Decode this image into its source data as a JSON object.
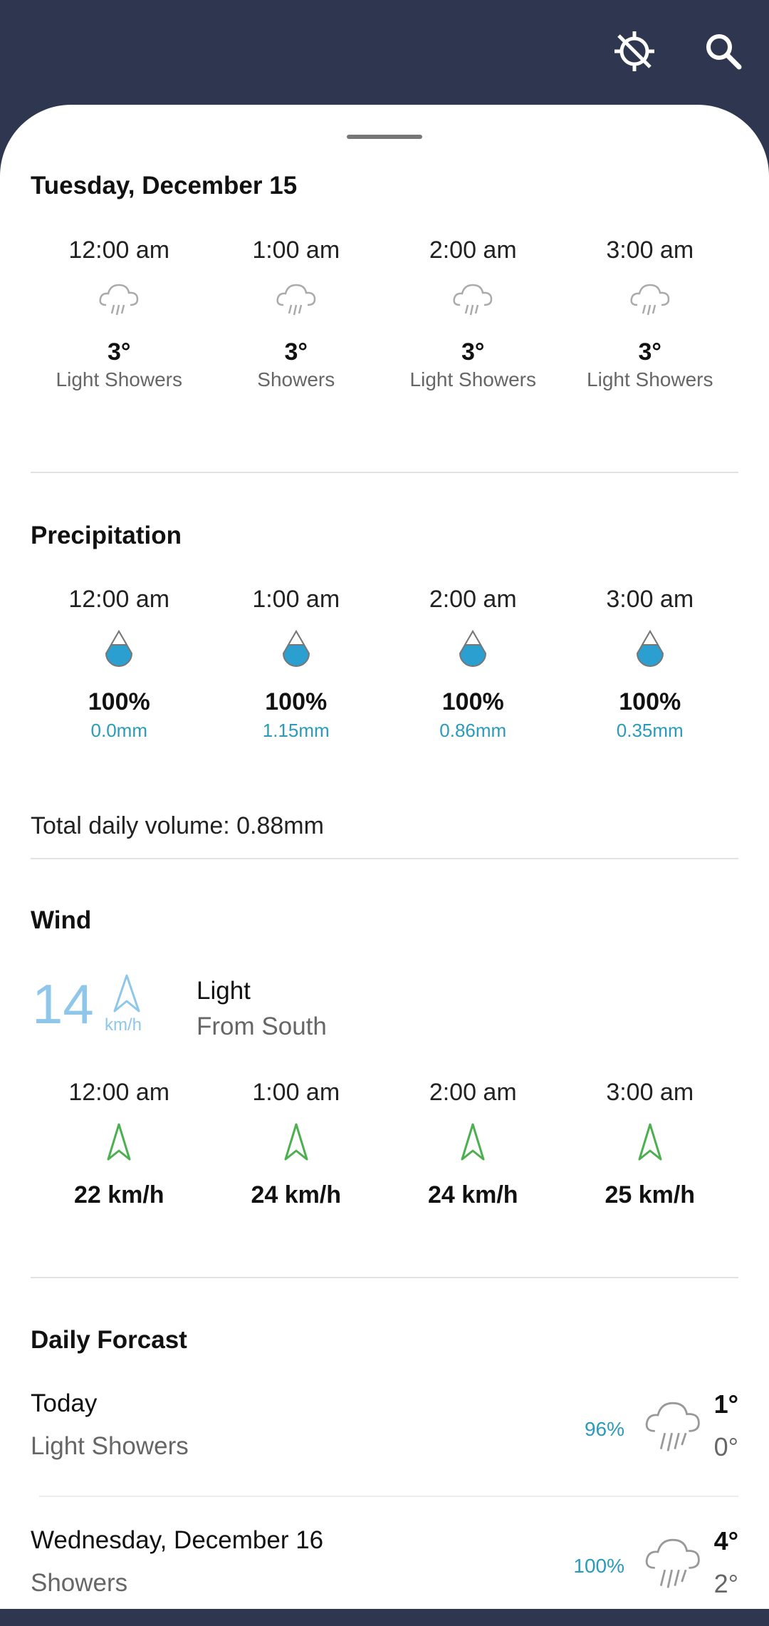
{
  "header": {
    "location_icon": "location-disabled-icon",
    "search_icon": "search-icon"
  },
  "hourly": {
    "date_title": "Tuesday, December 15",
    "items": [
      {
        "time": "12:00 am",
        "temp": "3°",
        "condition": "Light Showers",
        "icon": "rain-cloud-icon"
      },
      {
        "time": "1:00 am",
        "temp": "3°",
        "condition": "Showers",
        "icon": "rain-cloud-icon"
      },
      {
        "time": "2:00 am",
        "temp": "3°",
        "condition": "Light Showers",
        "icon": "rain-cloud-icon"
      },
      {
        "time": "3:00 am",
        "temp": "3°",
        "condition": "Light Showers",
        "icon": "rain-cloud-icon"
      }
    ]
  },
  "precipitation": {
    "title": "Precipitation",
    "items": [
      {
        "time": "12:00 am",
        "chance": "100%",
        "amount": "0.0mm"
      },
      {
        "time": "1:00 am",
        "chance": "100%",
        "amount": "1.15mm"
      },
      {
        "time": "2:00 am",
        "chance": "100%",
        "amount": "0.86mm"
      },
      {
        "time": "3:00 am",
        "chance": "100%",
        "amount": "0.35mm"
      }
    ],
    "total": "Total daily volume: 0.88mm",
    "drop_color": "#2a9fd0"
  },
  "wind": {
    "title": "Wind",
    "current_speed": "14",
    "unit": "km/h",
    "strength": "Light",
    "direction": "From South",
    "accent_color": "#8ec7ea",
    "arrow_color": "#4caf50",
    "items": [
      {
        "time": "12:00 am",
        "speed": "22 km/h"
      },
      {
        "time": "1:00 am",
        "speed": "24 km/h"
      },
      {
        "time": "2:00 am",
        "speed": "24 km/h"
      },
      {
        "time": "3:00 am",
        "speed": "25 km/h"
      }
    ]
  },
  "daily": {
    "title": "Daily Forcast",
    "items": [
      {
        "day": "Today",
        "condition": "Light Showers",
        "chance": "96%",
        "high": "1°",
        "low": "0°"
      },
      {
        "day": "Wednesday, December 16",
        "condition": "Showers",
        "chance": "100%",
        "high": "4°",
        "low": "2°"
      }
    ]
  }
}
